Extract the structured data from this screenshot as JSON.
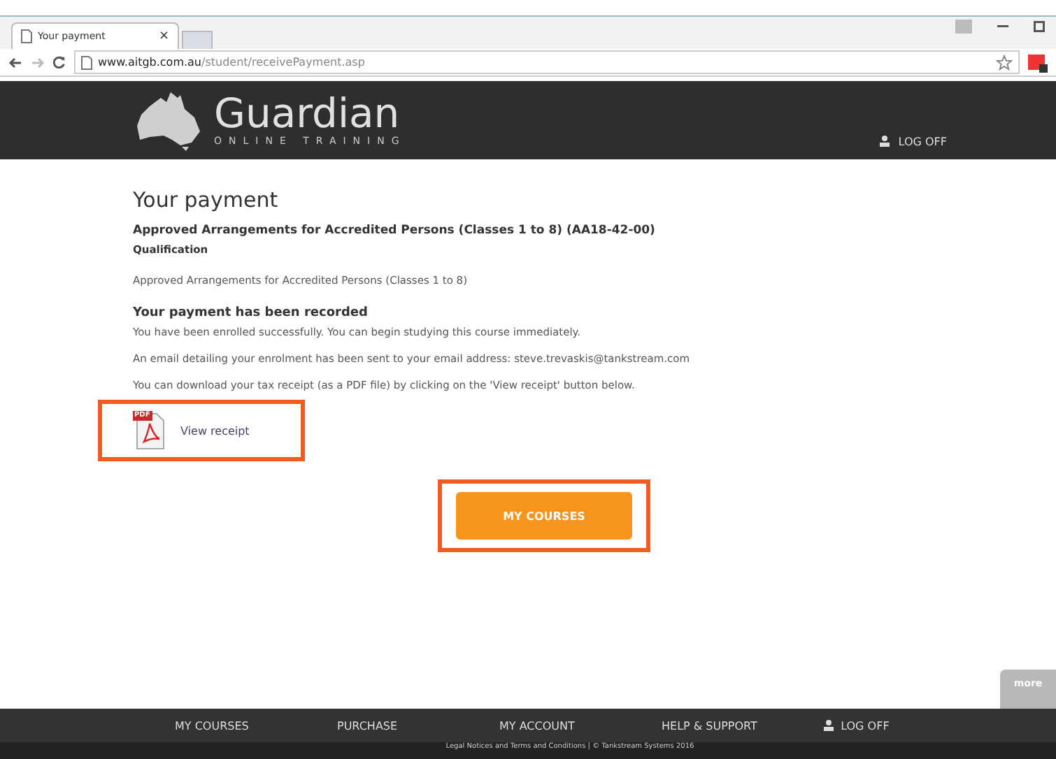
{
  "browser": {
    "tab_title": "Your payment",
    "tab_close": "×",
    "url_host": "www.aitgb.com.au",
    "url_path": "/student/receivePayment.asp"
  },
  "header": {
    "logo_title": "Guardian",
    "logo_subtitle": "ONLINE TRAINING",
    "logoff": "LOG OFF"
  },
  "content": {
    "title": "Your payment",
    "course": "Approved Arrangements for Accredited Persons (Classes 1 to 8) (AA18-42-00)",
    "qualification_label": "Qualification",
    "qualification": "Approved Arrangements for Accredited Persons (Classes 1 to 8)",
    "recorded_heading": "Your payment has been recorded",
    "paragraphs": [
      "You have been enrolled successfully. You can begin studying this course immediately.",
      "An email detailing your enrolment has been sent to your email address: steve.trevaskis@tankstream.com",
      "You can download your tax receipt (as a PDF file) by clicking on the 'View receipt' button below."
    ],
    "pdf_badge": "PDF",
    "receipt_link": "View receipt",
    "courses_button": "MY COURSES"
  },
  "more_tab": "more",
  "footer": {
    "nav": [
      {
        "label": "MY COURSES",
        "kind": "link"
      },
      {
        "label": "PURCHASE",
        "kind": "link"
      },
      {
        "label": "MY ACCOUNT",
        "kind": "link"
      },
      {
        "label": "HELP & SUPPORT",
        "kind": "link"
      },
      {
        "label": "LOG OFF",
        "kind": "user"
      }
    ],
    "legal": "Legal Notices and Terms and Conditions   | © Tankstream Systems 2016"
  }
}
